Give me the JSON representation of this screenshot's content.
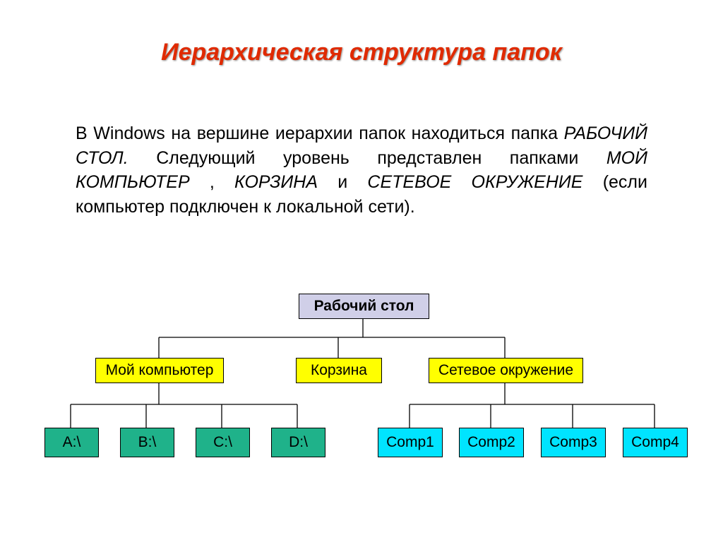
{
  "title": "Иерархическая структура папок",
  "paragraph": {
    "t1": "В Windows на вершине иерархии папок находиться папка ",
    "i1": "РАБОЧИЙ СТОЛ.",
    "t2": " Следующий уровень представлен папками ",
    "i2": "МОЙ КОМПЬЮТЕР",
    "t3": ", ",
    "i3": "КОРЗИНА",
    "t4": " и ",
    "i4": "СЕТЕВОЕ ОКРУЖЕНИЕ",
    "t5": " (если компьютер подключен к локальной сети)."
  },
  "nodes": {
    "root": "Рабочий стол",
    "mid1": "Мой компьютер",
    "mid2": "Корзина",
    "mid3": "Сетевое окружение",
    "d1": "A:\\",
    "d2": "B:\\",
    "d3": "C:\\",
    "d4": "D:\\",
    "c1": "Comp1",
    "c2": "Comp2",
    "c3": "Comp3",
    "c4": "Comp4"
  },
  "chart_data": {
    "type": "tree",
    "title": "Иерархическая структура папок",
    "root": {
      "label": "Рабочий стол",
      "children": [
        {
          "label": "Мой компьютер",
          "children": [
            {
              "label": "A:\\"
            },
            {
              "label": "B:\\"
            },
            {
              "label": "C:\\"
            },
            {
              "label": "D:\\"
            }
          ]
        },
        {
          "label": "Корзина",
          "children": []
        },
        {
          "label": "Сетевое окружение",
          "children": [
            {
              "label": "Comp1"
            },
            {
              "label": "Comp2"
            },
            {
              "label": "Comp3"
            },
            {
              "label": "Comp4"
            }
          ]
        }
      ]
    }
  }
}
